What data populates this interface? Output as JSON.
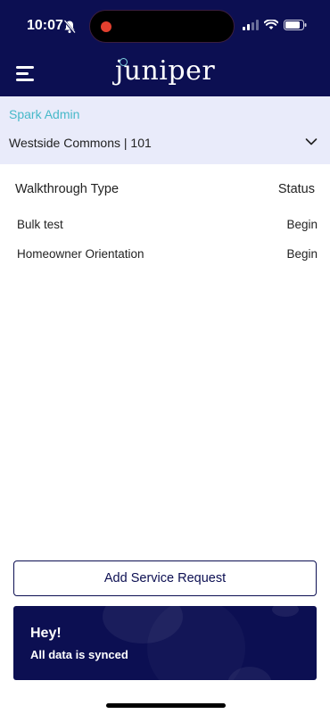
{
  "status_bar": {
    "time": "10:07",
    "icons": [
      "bell-slash-icon",
      "signal-icon",
      "wifi-icon",
      "battery-icon"
    ]
  },
  "header": {
    "logo_text": "juniper",
    "menu_icon": "hamburger-menu-icon"
  },
  "context": {
    "organization": "Spark Admin",
    "property": "Westside Commons | 101"
  },
  "table": {
    "columns": {
      "type": "Walkthrough Type",
      "status": "Status"
    },
    "rows": [
      {
        "name": "Bulk test",
        "action": "Begin"
      },
      {
        "name": "Homeowner Orientation",
        "action": "Begin"
      }
    ]
  },
  "actions": {
    "add_service_request": "Add Service Request"
  },
  "sync_banner": {
    "title": "Hey!",
    "message": "All data is synced"
  },
  "colors": {
    "navy": "#0c0f52",
    "teal": "#47b9c9",
    "panel": "#e9ebfa"
  }
}
